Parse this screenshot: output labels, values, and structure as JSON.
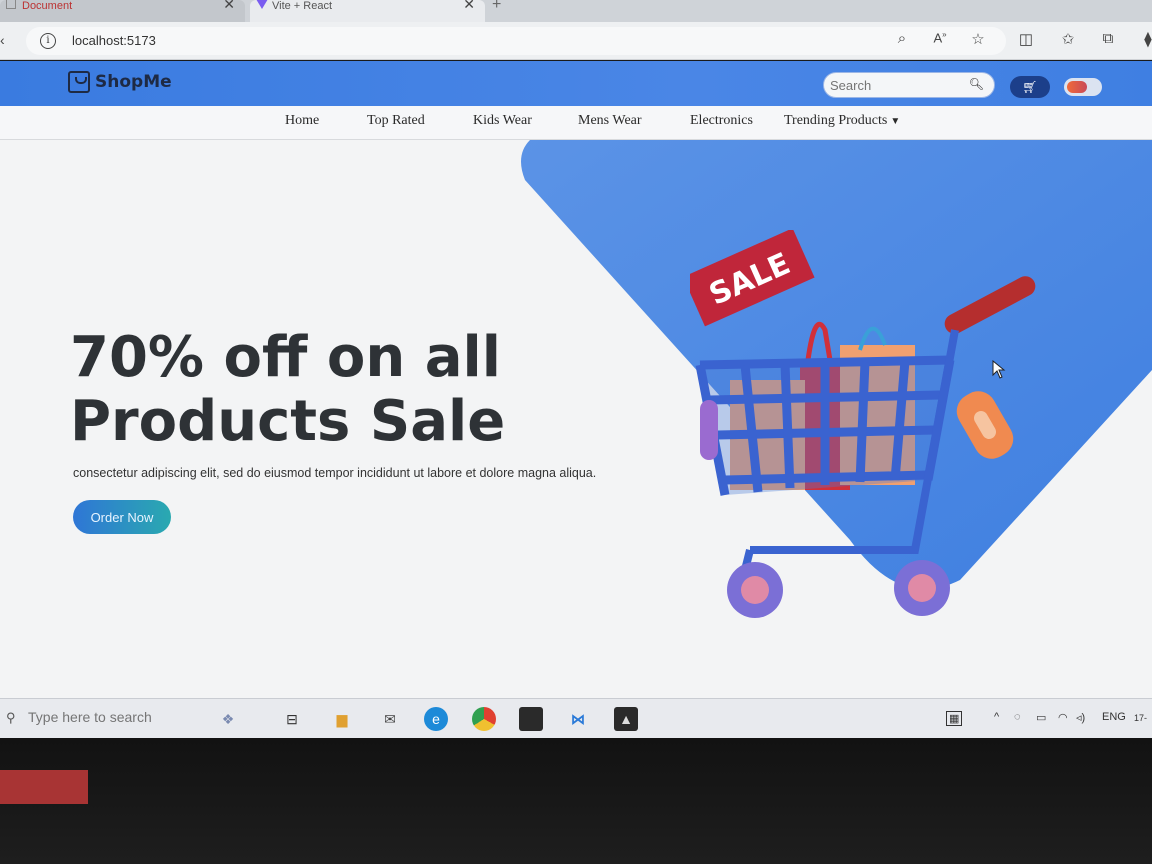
{
  "browser": {
    "tabs": [
      {
        "label": "Document"
      },
      {
        "label": "Vite + React"
      }
    ],
    "url": "localhost:5173"
  },
  "app": {
    "logo": "ShopMe",
    "search": {
      "placeholder": "Search"
    },
    "nav": [
      {
        "label": "Home"
      },
      {
        "label": "Top Rated"
      },
      {
        "label": "Kids Wear"
      },
      {
        "label": "Mens Wear"
      },
      {
        "label": "Electronics"
      },
      {
        "label": "Trending Products"
      }
    ]
  },
  "hero": {
    "headline_line1": "70% off on all",
    "headline_line2": "Products Sale",
    "subtext": "consectetur adipiscing elit, sed do eiusmod tempor incididunt ut labore et dolore magna aliqua.",
    "cta": "Order Now",
    "sale_tag": "SALE"
  },
  "taskbar": {
    "search_placeholder": "Type here to search",
    "language": "ENG",
    "clock_partial": "17-"
  },
  "colors": {
    "header_blue": "#4a86e6",
    "sale_red": "#c0263a",
    "hero_bg": "#f3f4f5"
  }
}
